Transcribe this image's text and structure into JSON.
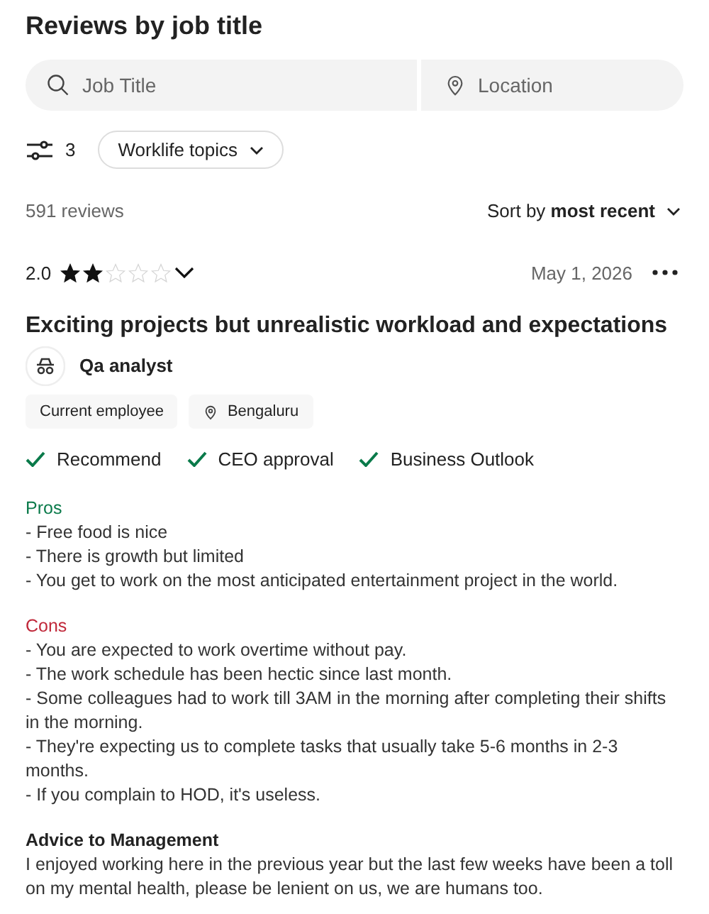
{
  "heading": "Reviews by job title",
  "search": {
    "job_placeholder": "Job Title",
    "location_placeholder": "Location"
  },
  "filters": {
    "count": "3",
    "topics_label": "Worklife topics"
  },
  "summary": {
    "count": "591 reviews",
    "sort_prefix": "Sort by",
    "sort_value": "most recent"
  },
  "review": {
    "rating": "2.0",
    "stars": 2,
    "date": "May 1, 2026",
    "title": "Exciting projects but unrealistic workload and expectations",
    "job": "Qa analyst",
    "tags": [
      {
        "kind": "plain",
        "label": "Current employee"
      },
      {
        "kind": "location",
        "label": "Bengaluru"
      }
    ],
    "approvals": [
      {
        "label": "Recommend",
        "checked": true
      },
      {
        "label": "CEO approval",
        "checked": true
      },
      {
        "label": "Business Outlook",
        "checked": true
      }
    ],
    "sections": [
      {
        "kind": "pros",
        "heading": "Pros",
        "lines": [
          "- Free food is nice",
          "- There is growth but limited",
          "- You get to work on the most anticipated entertainment project in the world."
        ]
      },
      {
        "kind": "cons",
        "heading": "Cons",
        "lines": [
          "- You are expected to work overtime without pay.",
          "- The work schedule has been hectic since last month.",
          "- Some colleagues had to work till 3AM in the morning after completing their shifts in the morning.",
          "- They're expecting us to complete tasks that usually take 5-6 months in 2-3 months.",
          "- If you complain to HOD, it's useless."
        ]
      },
      {
        "kind": "advice",
        "heading": "Advice to Management",
        "lines": [
          "I enjoyed working here in the previous year but the last few weeks have been a toll on my mental health, please be lenient on us, we are humans too."
        ]
      }
    ]
  }
}
